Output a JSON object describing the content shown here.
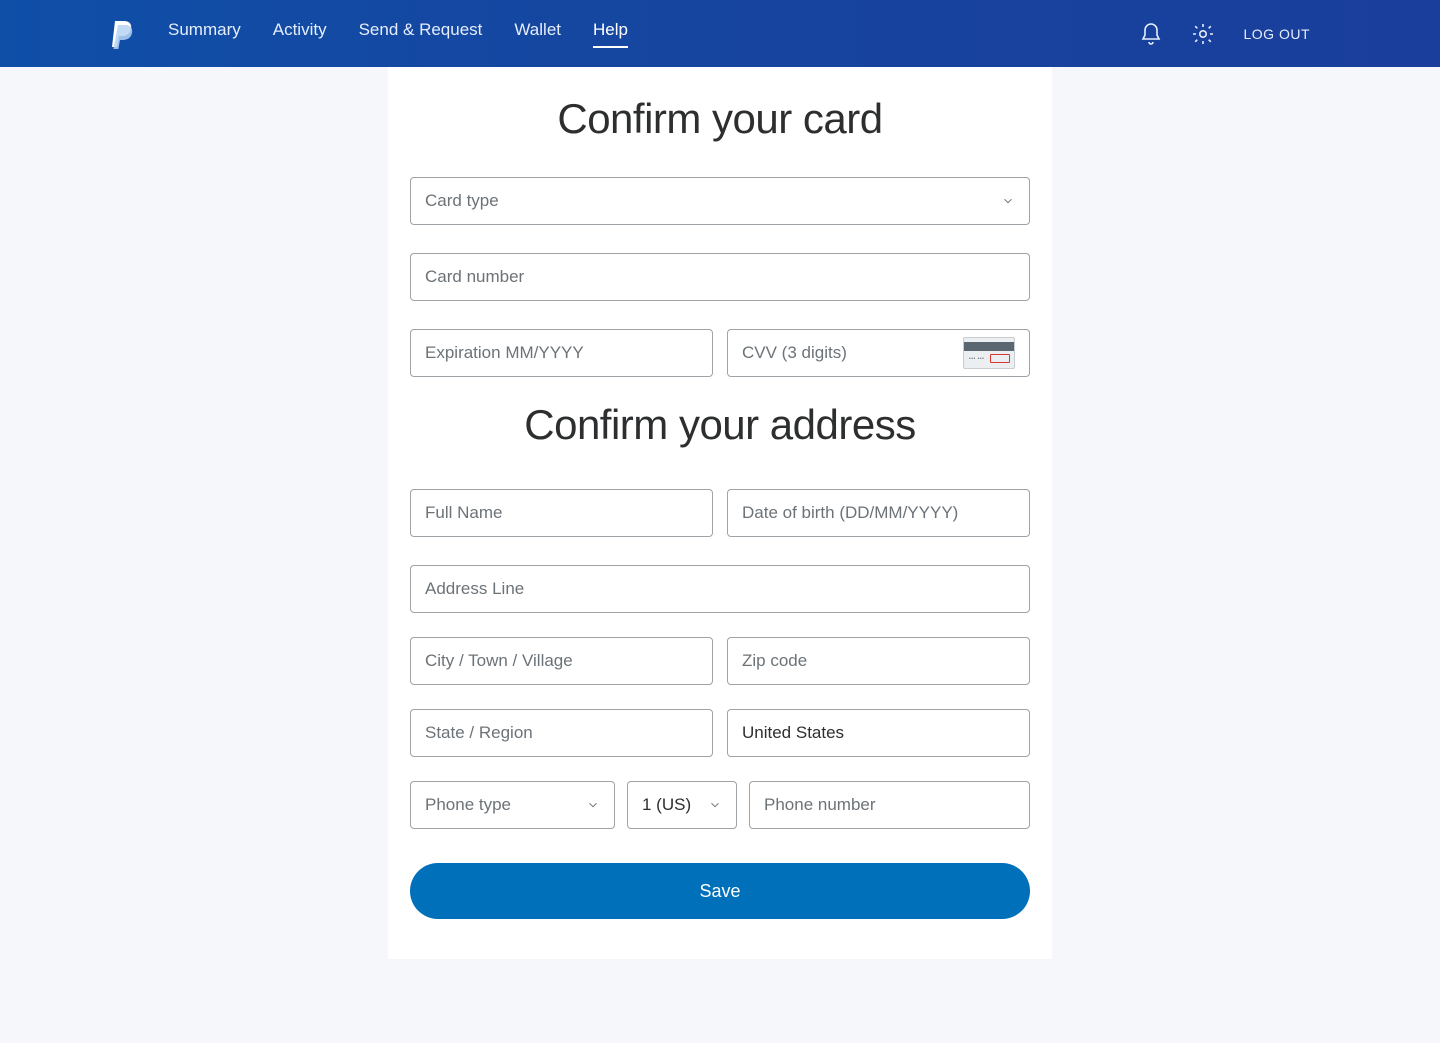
{
  "nav": {
    "summary": "Summary",
    "activity": "Activity",
    "send_request": "Send & Request",
    "wallet": "Wallet",
    "help": "Help"
  },
  "header": {
    "logout": "LOG OUT"
  },
  "card_section": {
    "title": "Confirm your card",
    "card_type_placeholder": "Card type",
    "card_number_placeholder": "Card number",
    "expiration_placeholder": "Expiration MM/YYYY",
    "cvv_placeholder": "CVV (3 digits)"
  },
  "address_section": {
    "title": "Confirm your address",
    "full_name_placeholder": "Full Name",
    "dob_placeholder": "Date of birth (DD/MM/YYYY)",
    "address_line_placeholder": "Address Line",
    "city_placeholder": "City / Town / Village",
    "zip_placeholder": "Zip code",
    "state_placeholder": "State / Region",
    "country_value": "United States",
    "phone_type_placeholder": "Phone type",
    "phone_cc_value": "1 (US)",
    "phone_number_placeholder": "Phone number"
  },
  "actions": {
    "save": "Save"
  }
}
